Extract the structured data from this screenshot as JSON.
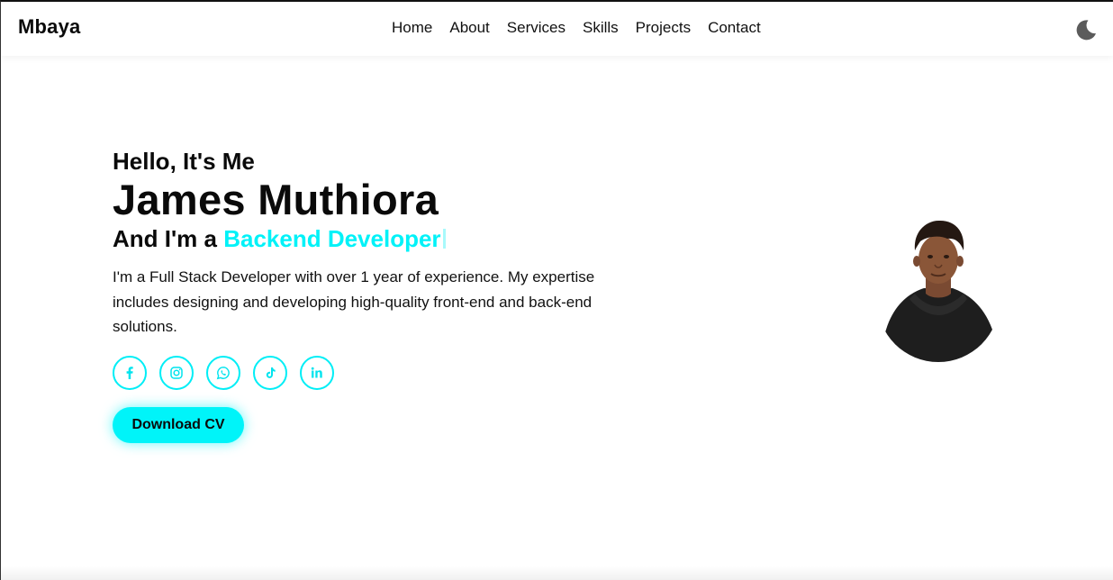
{
  "brand": {
    "logo": "Mbaya"
  },
  "nav": {
    "items": [
      {
        "label": "Home"
      },
      {
        "label": "About"
      },
      {
        "label": "Services"
      },
      {
        "label": "Skills"
      },
      {
        "label": "Projects"
      },
      {
        "label": "Contact"
      }
    ],
    "theme_toggle_icon": "moon-icon"
  },
  "hero": {
    "greeting": "Hello, It's Me",
    "name": "James Muthiora",
    "role_prefix": "And I'm a",
    "role": "Backend Developer",
    "description": "I'm a Full Stack Developer with over 1 year of experience. My expertise includes designing and developing high-quality front-end and back-end solutions.",
    "socials": [
      {
        "icon": "facebook-icon"
      },
      {
        "icon": "instagram-icon"
      },
      {
        "icon": "whatsapp-icon"
      },
      {
        "icon": "tiktok-icon"
      },
      {
        "icon": "linkedin-icon"
      }
    ],
    "cta_label": "Download CV"
  },
  "colors": {
    "accent": "#00f2f8",
    "text": "#0a0a0a",
    "background": "#ffffff"
  }
}
